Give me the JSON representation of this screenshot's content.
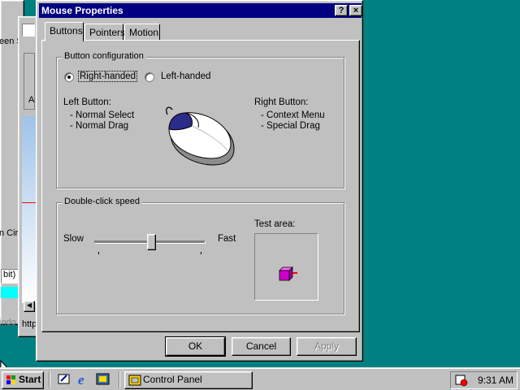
{
  "background": {
    "desktop_color": "#008080"
  },
  "bg_windows": {
    "fragments": [
      "een S",
      "A",
      "n Cir",
      "bit)",
      "indo",
      "http"
    ]
  },
  "dialog": {
    "title": "Mouse Properties",
    "help_label": "?",
    "close_label": "×",
    "tabs": [
      {
        "label": "Buttons",
        "active": true
      },
      {
        "label": "Pointers",
        "active": false
      },
      {
        "label": "Motion",
        "active": false
      }
    ],
    "button_config": {
      "title": "Button configuration",
      "options": [
        {
          "label": "Right-handed",
          "selected": true
        },
        {
          "label": "Left-handed",
          "selected": false
        }
      ],
      "left_button": {
        "heading": "Left Button:",
        "items": [
          "- Normal Select",
          "- Normal Drag"
        ]
      },
      "right_button": {
        "heading": "Right Button:",
        "items": [
          "- Context Menu",
          "- Special Drag"
        ]
      }
    },
    "double_click": {
      "title": "Double-click speed",
      "slow_label": "Slow",
      "fast_label": "Fast",
      "slider_value": 0.5,
      "test_area_label": "Test area:"
    },
    "buttons": {
      "ok": "OK",
      "cancel": "Cancel",
      "apply": "Apply"
    }
  },
  "taskbar": {
    "start_label": "Start",
    "task_label": "Control Panel",
    "time": "9:31 AM"
  }
}
